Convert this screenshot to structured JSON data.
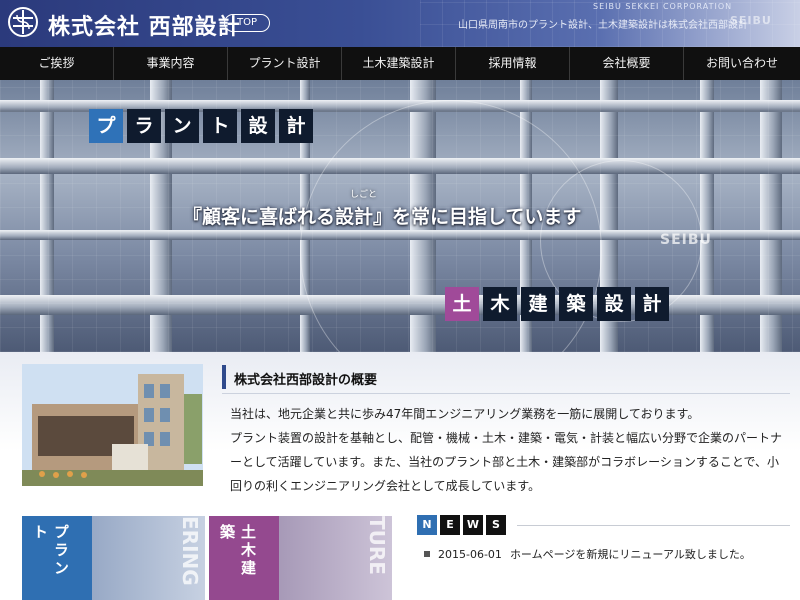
{
  "header": {
    "company_name": "株式会社 西部設計",
    "top_badge": "TOP",
    "english_name": "SEIBU SEKKEI CORPORATION",
    "tagline": "山口県周南市のプラント設計、土木建築設計は株式会社西部設計",
    "brand_stamp": "SEIBU"
  },
  "nav": {
    "items": [
      {
        "label": "ご挨拶"
      },
      {
        "label": "事業内容"
      },
      {
        "label": "プラント設計"
      },
      {
        "label": "土木建築設計"
      },
      {
        "label": "採用情報"
      },
      {
        "label": "会社概要"
      },
      {
        "label": "お問い合わせ"
      }
    ]
  },
  "hero": {
    "plant_chars": [
      "プ",
      "ラ",
      "ン",
      "ト",
      "設",
      "計"
    ],
    "civil_chars": [
      "土",
      "木",
      "建",
      "築",
      "設",
      "計"
    ],
    "ruby": "しごと",
    "catchphrase": "『顧客に喜ばれる設計』を常に目指しています",
    "watermark": "SEIBU"
  },
  "about": {
    "title": "株式会社西部設計の概要",
    "paragraphs": [
      "当社は、地元企業と共に歩み47年間エンジニアリング業務を一筋に展開しております。",
      "プラント装置の設計を基軸とし、配管・機械・土木・建築・電気・計装と幅広い分野で企業のパートナーとして活躍しています。また、当社のプラント部と土木・建築部がコラボレーションすることで、小回りの利くエンジニアリング会社として成長しています。"
    ]
  },
  "cards": {
    "plant_label": "プラント",
    "plant_watermark": "ERING",
    "civil_label": "土木建築",
    "civil_watermark": "TURE"
  },
  "news": {
    "heading_chars": [
      "N",
      "E",
      "W",
      "S"
    ],
    "items": [
      {
        "date": "2015-06-01",
        "text": "ホームページを新規にリニューアル致しました。"
      }
    ]
  },
  "colors": {
    "header_blue": "#2b3a7c",
    "plant_blue": "#2f72b8",
    "civil_purple": "#a04a99",
    "nav_black": "#101010"
  }
}
